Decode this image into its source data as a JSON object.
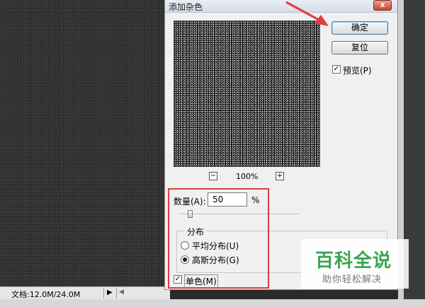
{
  "canvas": {
    "status_text": "文档:12.0M/24.0M",
    "arrow_glyph": "▶",
    "scroll_left_glyph": "◀"
  },
  "dialog": {
    "title": "添加杂色",
    "close_glyph": "x",
    "ok_label": "确定",
    "reset_label": "复位",
    "preview_label": "预览(P)",
    "preview_checked": true,
    "zoom": {
      "minus_glyph": "−",
      "plus_glyph": "+",
      "value": "100%"
    },
    "amount_label": "数量(A):",
    "amount_value": "50",
    "amount_unit": "%",
    "amount_slider_fraction": 0.1,
    "distribution": {
      "title": "分布",
      "options": [
        {
          "label": "平均分布(U)",
          "selected": false
        },
        {
          "label": "高斯分布(G)",
          "selected": true
        }
      ]
    },
    "monochrome_label": "单色(M)",
    "monochrome_checked": true,
    "check_glyph": "✓"
  },
  "annotation": {
    "color": "#e03c3c"
  },
  "watermark": {
    "title": "百科全说",
    "subtitle": "助你轻松解决",
    "color": "#3aa552"
  }
}
